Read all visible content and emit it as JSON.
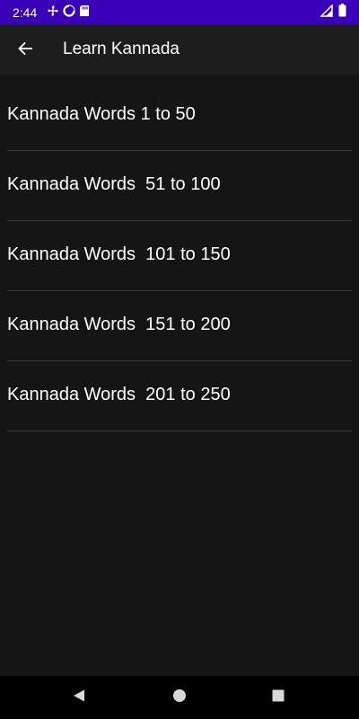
{
  "status_bar": {
    "time": "2:44",
    "left_icons": [
      "fan-icon",
      "data-saver-icon",
      "sd-card-icon"
    ],
    "right_icons": [
      "signal-icon",
      "battery-icon"
    ],
    "color": "#3a00b8"
  },
  "app_bar": {
    "back_icon": "arrow-back-icon",
    "title": "Learn Kannada"
  },
  "list": {
    "items": [
      {
        "label": "Kannada Words 1 to 50"
      },
      {
        "label": "Kannada Words  51 to 100"
      },
      {
        "label": "Kannada Words  101 to 150"
      },
      {
        "label": "Kannada Words  151 to 200"
      },
      {
        "label": "Kannada Words  201 to 250"
      }
    ]
  },
  "nav_bar": {
    "buttons": [
      "back-triangle-icon",
      "home-circle-icon",
      "recents-square-icon"
    ]
  },
  "colors": {
    "background": "#151515",
    "app_bar": "#1d1d1d",
    "divider": "#3a3a3a",
    "text": "#ffffff"
  }
}
